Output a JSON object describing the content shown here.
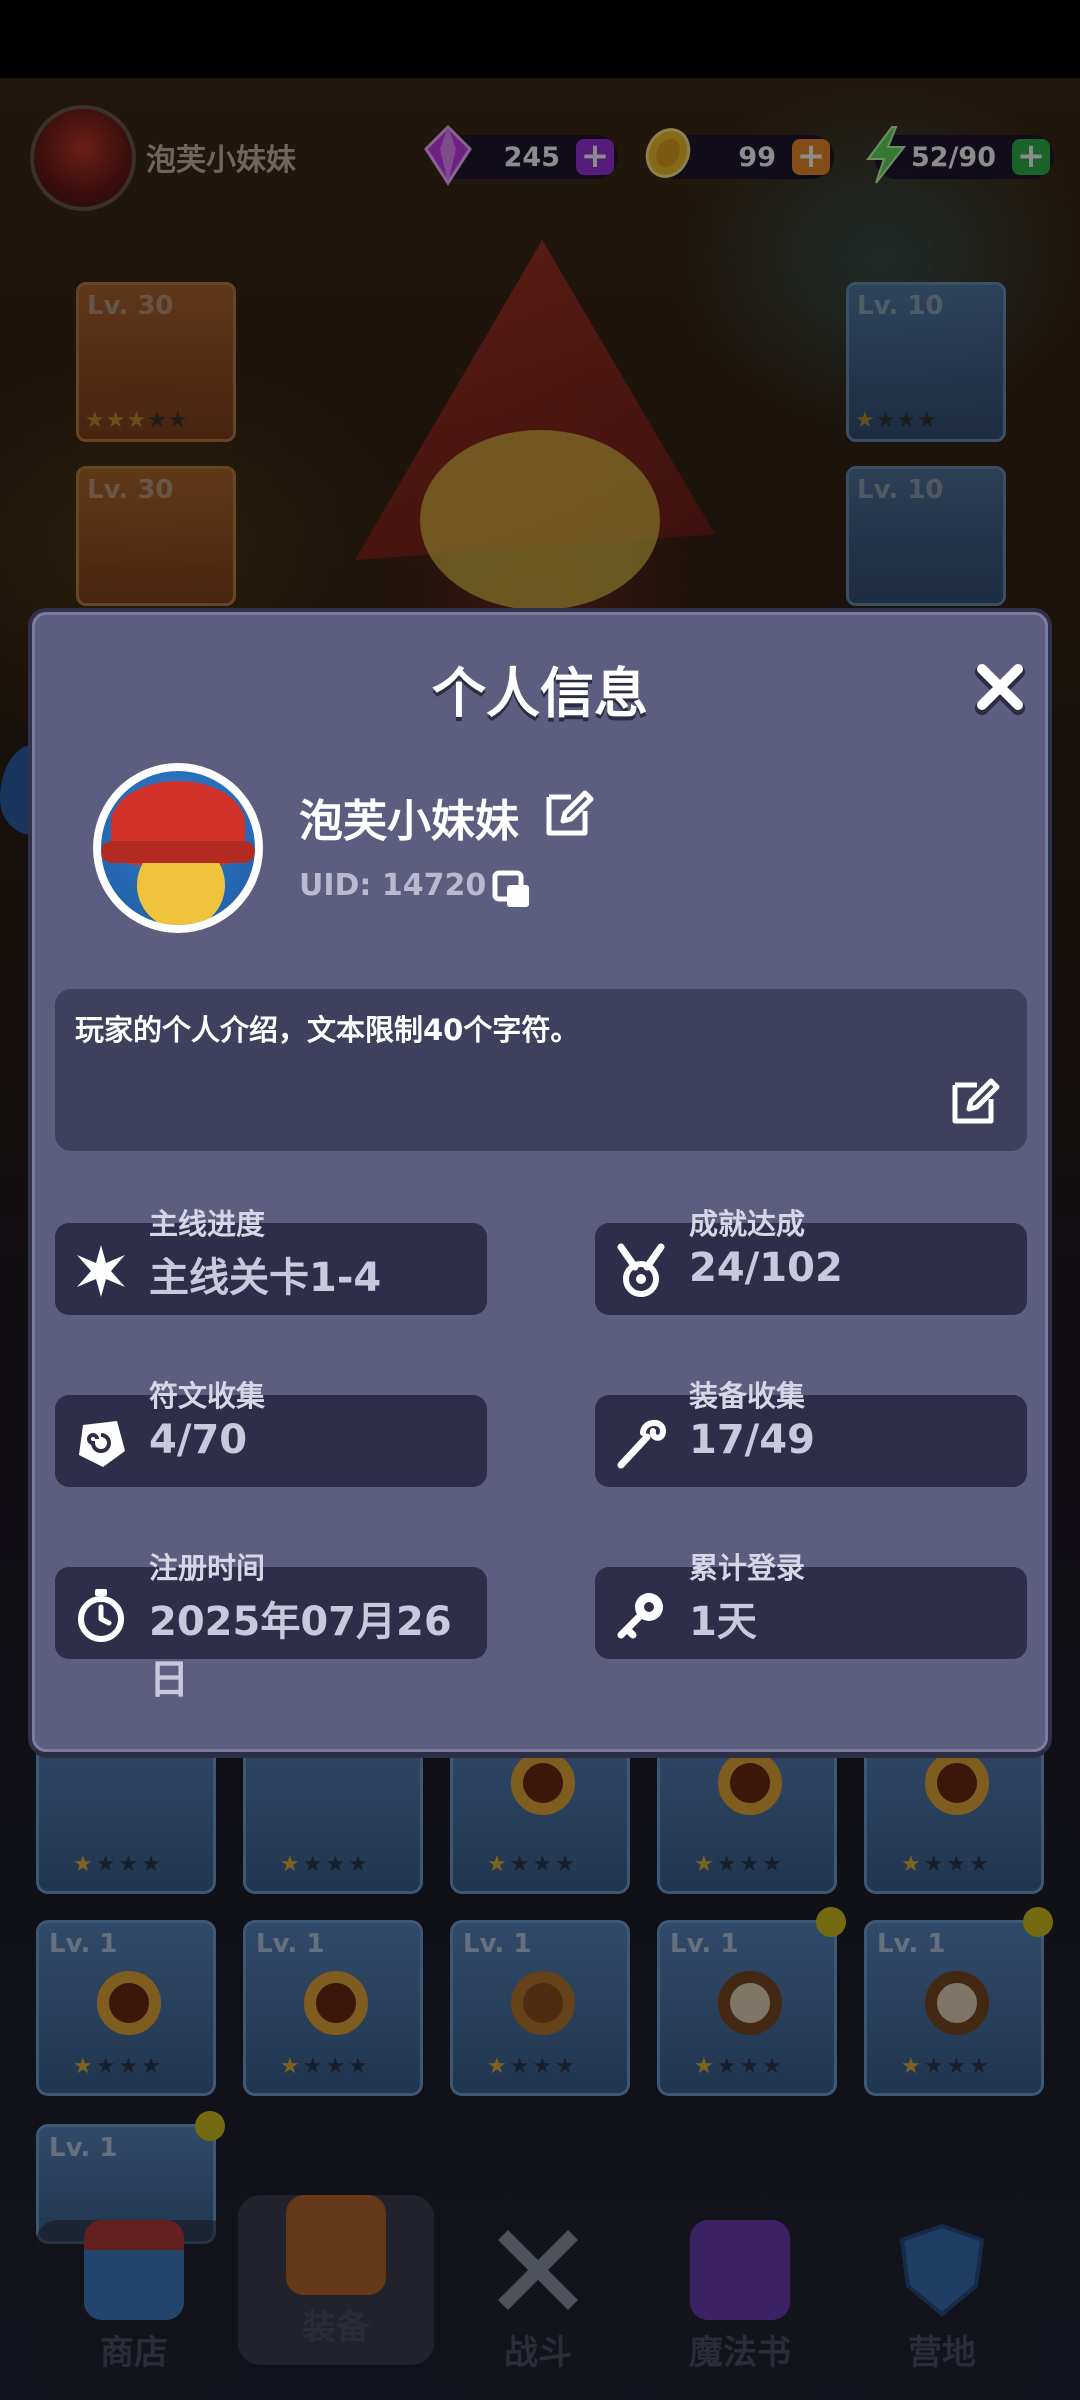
{
  "hud": {
    "player_name": "泡芙小妹妹",
    "gems": "245",
    "gold": "99",
    "energy": "52/90",
    "plus": "+"
  },
  "equipment": {
    "lv30": "Lv. 30",
    "lv10": "Lv. 10",
    "lv1": "Lv. 1"
  },
  "profile": {
    "title": "个人信息",
    "name": "泡芙小妹妹",
    "uid": "UID: 14720",
    "intro": "玩家的个人介绍，文本限制40个字符。"
  },
  "stats": {
    "main_progress": {
      "label": "主线进度",
      "value": "主线关卡1-4"
    },
    "achievement": {
      "label": "成就达成",
      "value": "24/102"
    },
    "rune": {
      "label": "符文收集",
      "value": "4/70"
    },
    "equip": {
      "label": "装备收集",
      "value": "17/49"
    },
    "register": {
      "label": "注册时间",
      "value": "2025年07月26日"
    },
    "login": {
      "label": "累计登录",
      "value": "1天"
    }
  },
  "nav": {
    "shop": "商店",
    "equipment": "装备",
    "battle": "战斗",
    "magic_book": "魔法书",
    "camp": "营地"
  },
  "colors": {
    "modal_bg": "#5c5d7f",
    "stat_bg": "#2e2e4a",
    "gem_plus": "#9b33e0",
    "gold_plus": "#f08a2a",
    "energy_plus": "#2fb34a"
  }
}
